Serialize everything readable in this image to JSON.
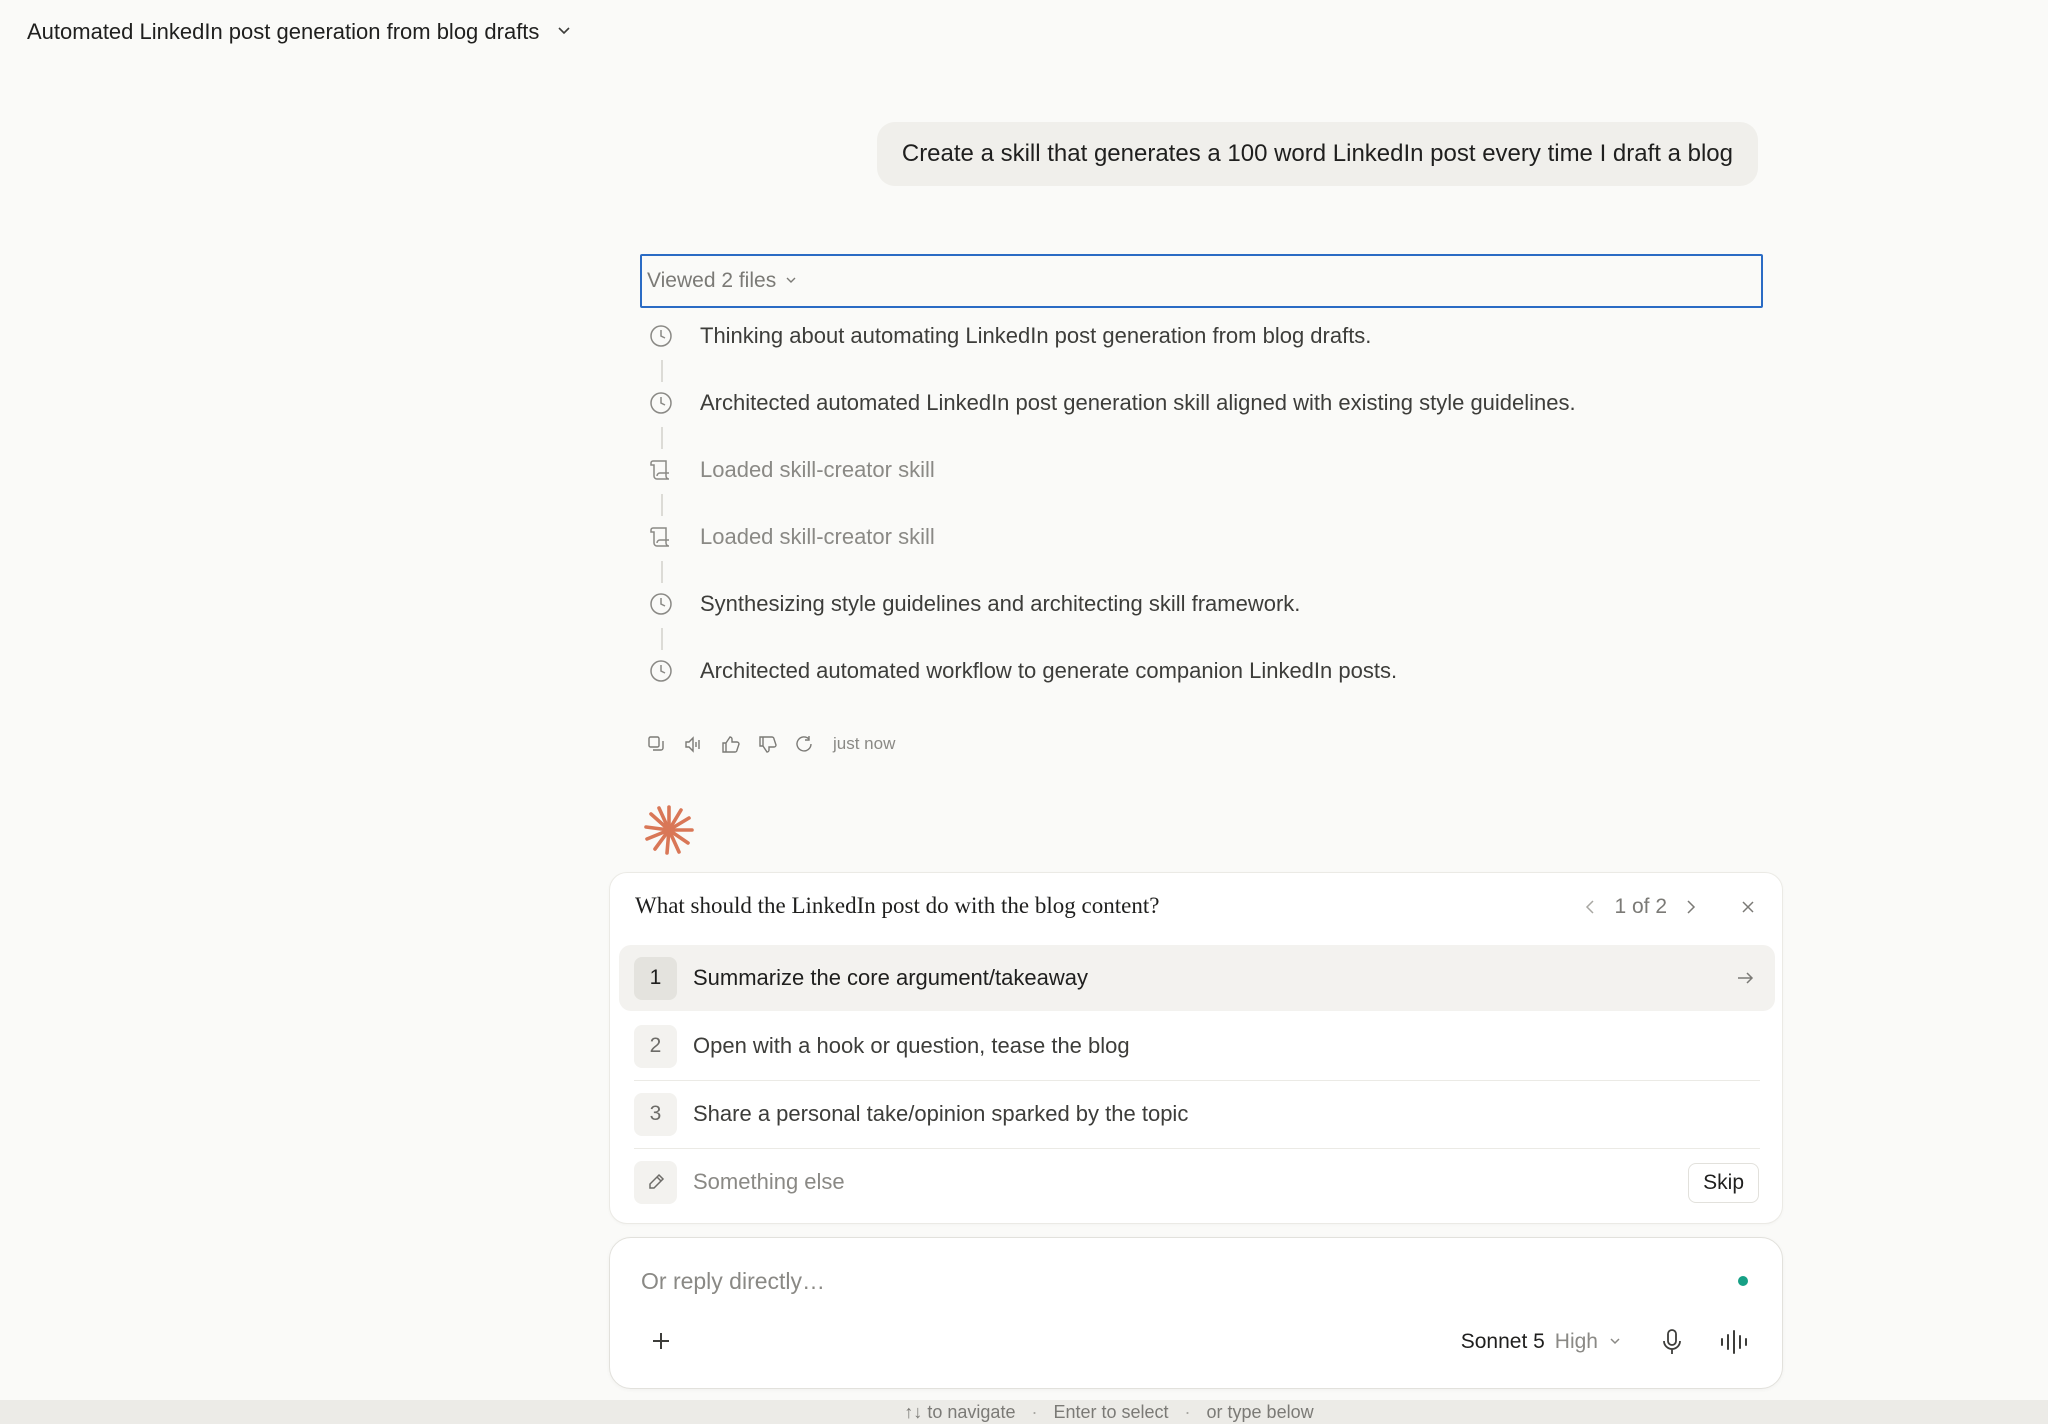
{
  "header": {
    "title": "Automated LinkedIn post generation from blog drafts"
  },
  "user_message": "Create a skill that generates a 100 word LinkedIn post every time I draft a blog",
  "viewed": {
    "label": "Viewed 2 files"
  },
  "timeline": [
    {
      "icon": "clock-icon",
      "text": "Thinking about automating LinkedIn post generation from blog drafts."
    },
    {
      "icon": "clock-icon",
      "text": "Architected automated LinkedIn post generation skill aligned with existing style guidelines."
    },
    {
      "icon": "scroll-icon",
      "text": "Loaded skill-creator skill"
    },
    {
      "icon": "scroll-icon",
      "text": "Loaded skill-creator skill"
    },
    {
      "icon": "clock-icon",
      "text": "Synthesizing style guidelines and architecting skill framework."
    },
    {
      "icon": "clock-icon",
      "text": "Architected automated workflow to generate companion LinkedIn posts."
    }
  ],
  "actions": {
    "timestamp": "just now"
  },
  "question": {
    "title": "What should the LinkedIn post do with the blog content?",
    "pager": "1 of 2",
    "options": [
      {
        "num": "1",
        "label": "Summarize the core argument/takeaway"
      },
      {
        "num": "2",
        "label": "Open with a hook or question, tease the blog"
      },
      {
        "num": "3",
        "label": "Share a personal take/opinion sparked by the topic"
      }
    ],
    "other_placeholder": "Something else",
    "skip_label": "Skip"
  },
  "reply": {
    "placeholder": "Or reply directly…",
    "model": "Sonnet 5",
    "effort": "High"
  },
  "hint": {
    "navigate": "↑↓ to navigate",
    "select": "Enter to select",
    "type": "or type below",
    "separator": "·"
  },
  "colors": {
    "accent": "#d97757",
    "focus_border": "#2a6bc4",
    "status_dot": "#16a085"
  }
}
